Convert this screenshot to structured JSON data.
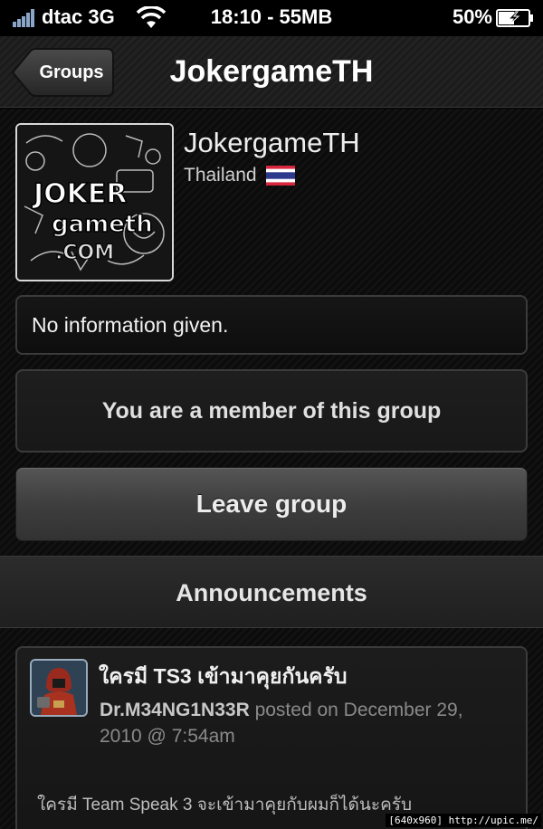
{
  "status_bar": {
    "carrier": "dtac 3G",
    "time_memory": "18:10 - 55MB",
    "battery": "50%",
    "signal_icon": "signal-bars-icon",
    "wifi_icon": "wifi-icon",
    "battery_icon": "battery-charging-icon"
  },
  "nav": {
    "back_label": "Groups",
    "title": "JokergameTH"
  },
  "group": {
    "name": "JokergameTH",
    "country": "Thailand",
    "flag_icon": "thailand-flag-icon",
    "avatar_text": "JOKER gameth .COM"
  },
  "info": {
    "text": "No information given."
  },
  "membership": {
    "status": "You are a member of this group",
    "leave_button": "Leave group"
  },
  "announcements": {
    "header": "Announcements",
    "items": [
      {
        "title": "ใครมี TS3 เข้ามาคุยกันครับ",
        "author": "Dr.M34NG1N33R",
        "posted_text": " posted on December 29, 2010 @ 7:54am",
        "body": "ใครมี Team Speak 3 จะเข้ามาคุยกับผมก็ได้นะครับ"
      }
    ]
  },
  "watermark": "[640x960] http://upic.me/"
}
